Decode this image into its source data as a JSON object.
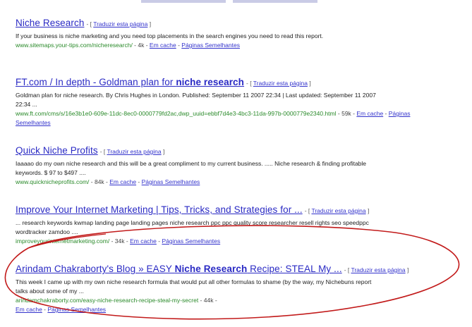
{
  "results": [
    {
      "title_pre": "Niche Research",
      "title_bold": "",
      "title_post": "",
      "translate_text": "Traduzir esta página",
      "snippet": "If your business is niche marketing and you need top placements in the search engines you need to read this report.",
      "url": "www.sitemaps.your-tips.com/nicheresearch/",
      "size": "4k",
      "cache_label": "Em cache",
      "similar_label": "Páginas Semelhantes"
    },
    {
      "title_pre": "FT.com / In depth - Goldman plan for ",
      "title_bold": "niche research",
      "title_post": "",
      "translate_text": "Traduzir esta página",
      "snippet": "Goldman plan for niche research. By Chris Hughes in London. Published: September 11 2007 22:34 | Last updated: September 11 2007 22:34 ...",
      "url": "www.ft.com/cms/s/16e3b1e0-609e-11dc-8ec0-0000779fd2ac,dwp_uuid=ebbf7d4e3-4bc3-11da-997b-0000779e2340.html",
      "size": "59k",
      "cache_label": "Em cache",
      "similar_label": "Páginas Semelhantes"
    },
    {
      "title_pre": "Quick Niche Profits",
      "title_bold": "",
      "title_post": "",
      "translate_text": "Traduzir esta página",
      "snippet": "Iaaaao do my own niche research and this will be a great compliment to my current business. ..... Niche research & finding profitable keywords. $ 97 to $497 ....",
      "url": "www.quicknicheprofits.com/",
      "size": "84k",
      "cache_label": "Em cache",
      "similar_label": "Páginas Semelhantes"
    },
    {
      "title_pre": "Improve Your Internet Marketing | Tips, Tricks, and Strategies for ...",
      "title_bold": "",
      "title_post": "",
      "translate_text": "Traduzir esta página",
      "snippet": "... research keywords kwmap landing page landing pages niche research ppc ppc quality score researcher resell rights seo speedppc wordtracker zamdoo ....",
      "url": "improveyourinternetmarketing.com/",
      "size": "34k",
      "cache_label": "Em cache",
      "similar_label": "Páginas Semelhantes"
    },
    {
      "title_pre": "Arindam Chakraborty's Blog » EASY ",
      "title_bold": "Niche Research",
      "title_post": " Recipe: STEAL My ...",
      "translate_text": "Traduzir esta página",
      "snippet": "This week I came up with my own niche research formula that would put all other formulas to shame (by the way, my Nichebuns report talks about some of my ...",
      "url": "arindamchakraborty.com/easy-niche-research-recipe-steal-my-secret",
      "size": "44k",
      "cache_label": "Em cache",
      "similar_label": "Páginas Semelhantes"
    }
  ],
  "colors": {
    "title_link": "#2a2ac4",
    "url_green": "#2a8a2a",
    "annotation_oval": "#c21a1a"
  }
}
